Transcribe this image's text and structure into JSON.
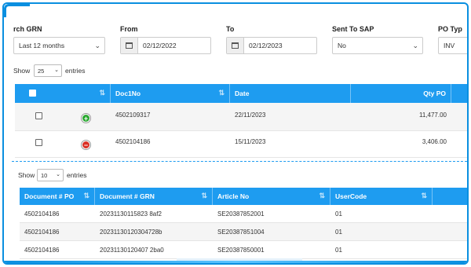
{
  "filters": {
    "search_grn_label": "rch GRN",
    "search_grn_value": "Last 12 months",
    "from_label": "From",
    "from_value": "02/12/2022",
    "to_label": "To",
    "to_value": "02/12/2023",
    "sap_label": "Sent To SAP",
    "sap_value": "No",
    "potype_label": "PO Typ",
    "potype_value": "INV"
  },
  "main_table": {
    "show_label": "Show",
    "page_size": "25",
    "entries_label": "entries",
    "columns": [
      "",
      "Doc1No",
      "Date",
      "Qty PO"
    ],
    "rows": [
      {
        "doc": "4502109317",
        "date": "22/11/2023",
        "qty": "11,477.00",
        "expand": "+"
      },
      {
        "doc": "4502104186",
        "date": "15/11/2023",
        "qty": "3,406.00",
        "expand": "−"
      }
    ]
  },
  "sub_table": {
    "show_label": "Show",
    "page_size": "10",
    "entries_label": "entries",
    "columns": [
      "Document # PO",
      "Document # GRN",
      "Article No",
      "UserCode"
    ],
    "rows": [
      {
        "po": "4502104186",
        "grn": "20231130115823 8af2",
        "article": "SE20387852001",
        "user": "01"
      },
      {
        "po": "4502104186",
        "grn": "20231130120304728b",
        "article": "SE20387851004",
        "user": "01"
      },
      {
        "po": "4502104186",
        "grn": "20231130120407 2ba0",
        "article": "SE20387850001",
        "user": "01"
      }
    ]
  },
  "colors": {
    "accent": "#1e9cf0",
    "border": "#0a8fe0"
  }
}
